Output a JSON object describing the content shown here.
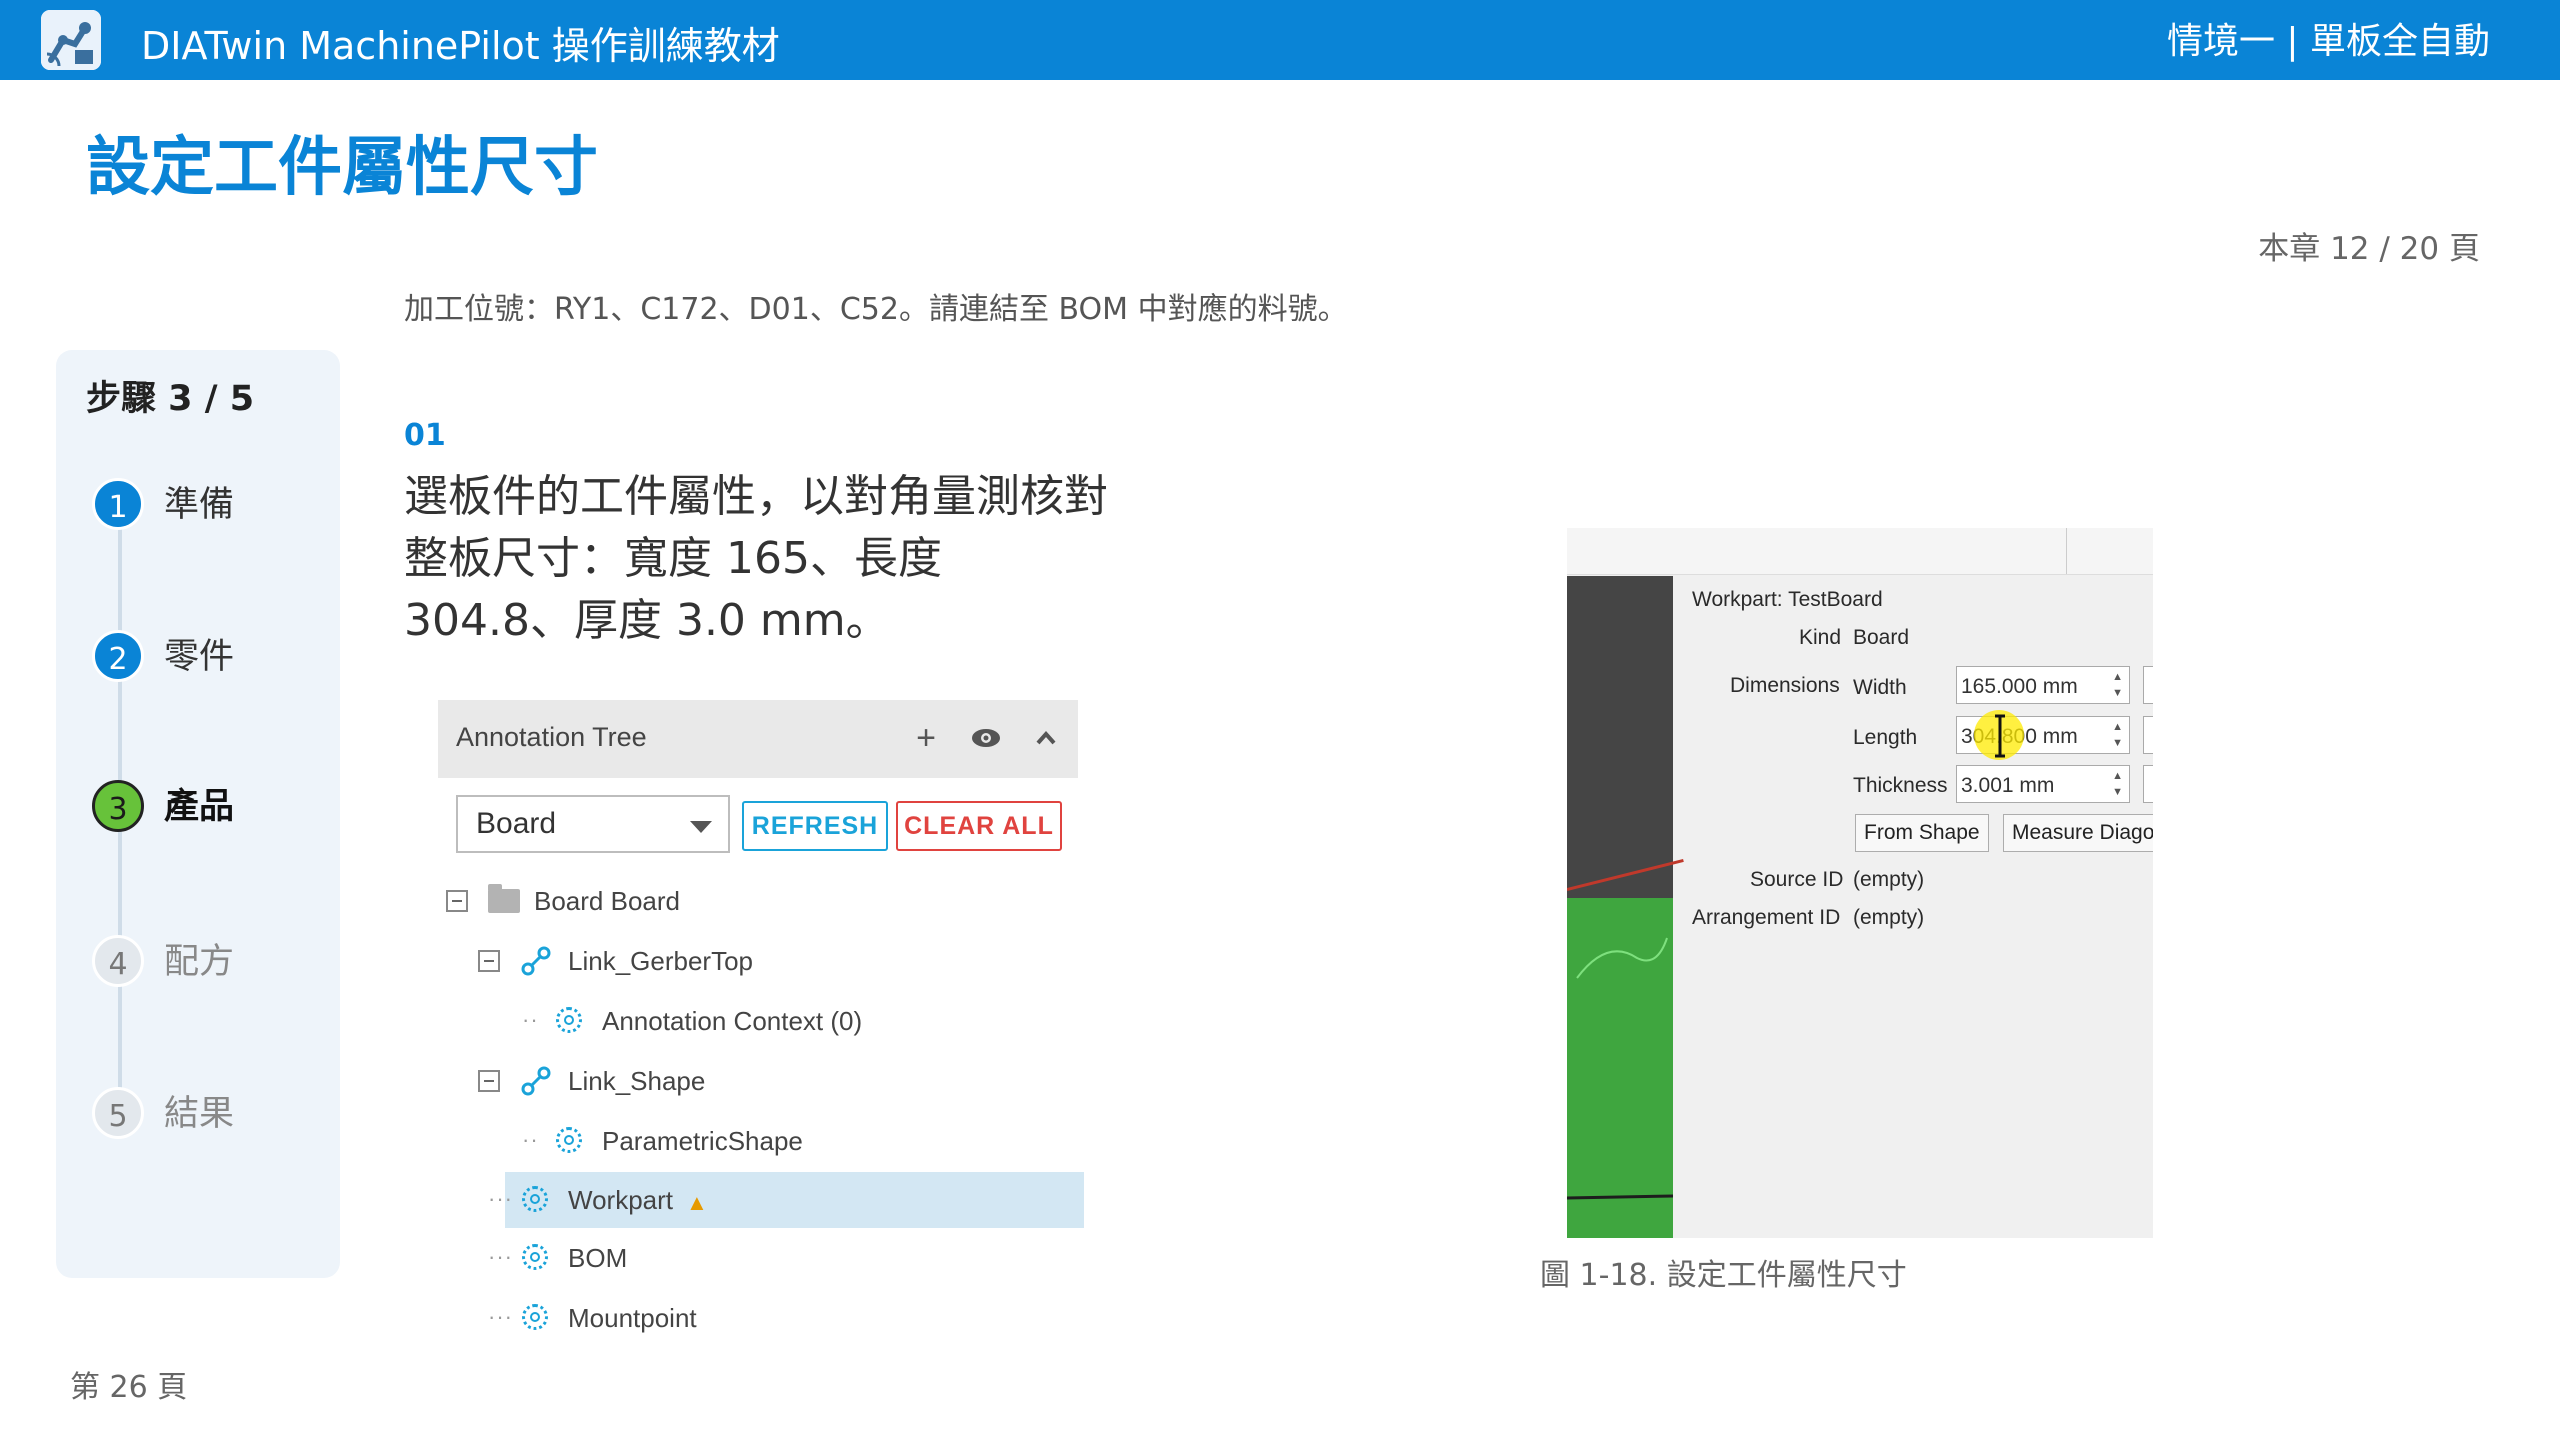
{
  "header": {
    "app_title": "DIATwin MachinePilot 操作訓練教材",
    "chapter": "情境一 | 單板全自動",
    "logo_icon": "robot-arm-icon",
    "bar_color": "#0a84d6"
  },
  "page": {
    "title": "設定工件屬性尺寸",
    "chapter_page": "本章 12 / 20 頁",
    "intro": "加工位號：RY1、C172、D01、C52。請連結至 BOM 中對應的料號。",
    "footer_page": "第 26 頁"
  },
  "steps": {
    "title": "步驟 3 / 5",
    "items": [
      {
        "num": "1",
        "label": "準備",
        "state": "done"
      },
      {
        "num": "2",
        "label": "零件",
        "state": "done"
      },
      {
        "num": "3",
        "label": "產品",
        "state": "current"
      },
      {
        "num": "4",
        "label": "配方",
        "state": "future"
      },
      {
        "num": "5",
        "label": "結果",
        "state": "future"
      }
    ]
  },
  "instruction": {
    "index": "01",
    "text": "選板件的工件屬性，以對角量測核對整板尺寸：寬度 165、長度 304.8、厚度 3.0 mm。"
  },
  "annotation_tree": {
    "title": "Annotation Tree",
    "icons": [
      "plus-icon",
      "eye-icon",
      "chevron-up-icon"
    ],
    "combo_value": "Board",
    "refresh_label": "REFRESH",
    "clear_label": "CLEAR ALL",
    "nodes": [
      {
        "label": "Board  Board",
        "icon": "folder-icon"
      },
      {
        "label": "Link_GerberTop",
        "icon": "link-icon"
      },
      {
        "label": "Annotation Context (0)",
        "icon": "gear-icon"
      },
      {
        "label": "Link_Shape",
        "icon": "link-icon"
      },
      {
        "label": "ParametricShape",
        "icon": "gear-icon"
      },
      {
        "label": "Workpart",
        "icon": "gear-icon",
        "selected": true,
        "warning": true
      },
      {
        "label": "BOM",
        "icon": "gear-icon"
      },
      {
        "label": "Mountpoint",
        "icon": "gear-icon"
      }
    ]
  },
  "figure": {
    "workpart": "Workpart: TestBoard",
    "kind_label": "Kind",
    "kind_value": "Board",
    "dimensions_label": "Dimensions",
    "width_label": "Width",
    "width_value": "165.000 mm",
    "length_label": "Length",
    "length_value": "304.800 mm",
    "thickness_label": "Thickness",
    "thickness_value": "3.001 mm",
    "from_shape": "From Shape",
    "measure_diag": "Measure Diagor",
    "source_label": "Source ID",
    "source_value": "(empty)",
    "arrangement_label": "Arrangement ID",
    "arrangement_value": "(empty)",
    "caption": "圖 1-18. 設定工件屬性尺寸"
  }
}
